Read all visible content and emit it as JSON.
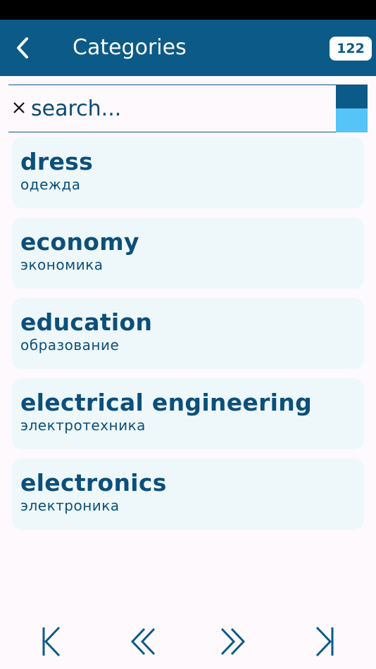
{
  "header": {
    "title": "Categories",
    "count": "122",
    "back_icon": "chevron-left-icon"
  },
  "search": {
    "placeholder": "search...",
    "value": "",
    "clear_icon": "close-icon"
  },
  "categories": [
    {
      "title": "dress",
      "translation": "одежда"
    },
    {
      "title": "economy",
      "translation": "экономика"
    },
    {
      "title": "education",
      "translation": "образование"
    },
    {
      "title": "electrical engineering",
      "translation": "электротехника"
    },
    {
      "title": "electronics",
      "translation": "электроника"
    }
  ],
  "pager": {
    "buttons": [
      "first-page-icon",
      "previous-page-icon",
      "next-page-icon",
      "last-page-icon"
    ]
  },
  "colors": {
    "primary": "#0c5a87",
    "accent": "#55c4f7",
    "item_bg": "#eef8fb",
    "text": "#0c4f7a"
  }
}
